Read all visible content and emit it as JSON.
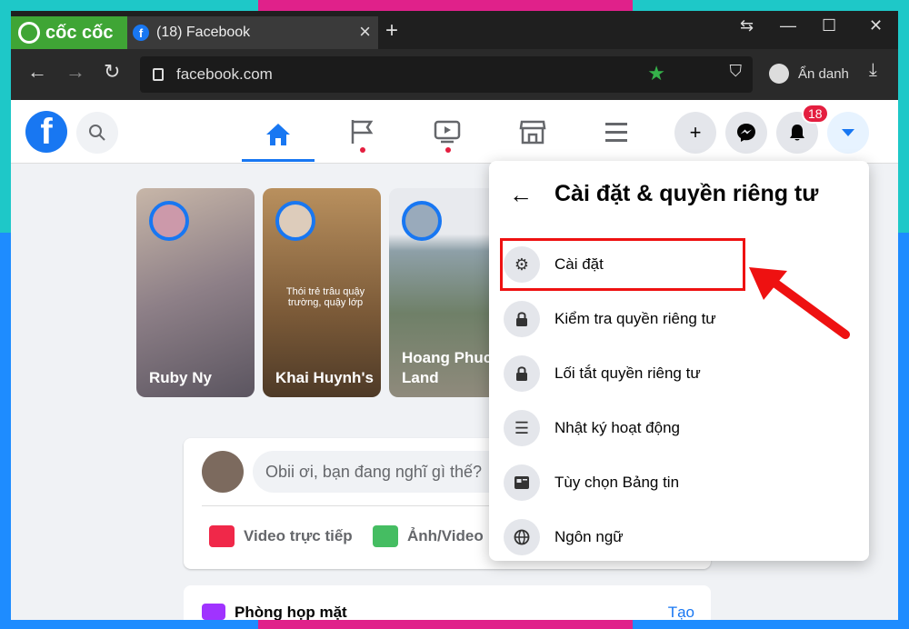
{
  "browser": {
    "brand": "cốc cốc",
    "tab_title": "(18) Facebook",
    "tab_favicon": "f",
    "url": "facebook.com",
    "incognito_label": "Ẩn danh"
  },
  "facebook": {
    "notification_count": "18"
  },
  "stories": [
    {
      "name": "Ruby Ny",
      "caption": ""
    },
    {
      "name": "Khai Huynh's",
      "caption": "Thói trẻ trâu quậy trường, quậy lớp"
    },
    {
      "name": "Hoang Phuc Land",
      "caption": ""
    }
  ],
  "composer": {
    "placeholder": "Obii ơi, bạn đang nghĩ gì thế?",
    "live_video": "Video trực tiếp",
    "photo_video": "Ảnh/Video"
  },
  "rooms": {
    "title": "Phòng họp mặt",
    "create": "Tạo"
  },
  "dropdown": {
    "title": "Cài đặt & quyền riêng tư",
    "items": [
      {
        "label": "Cài đặt",
        "icon": "gear-icon"
      },
      {
        "label": "Kiểm tra quyền riêng tư",
        "icon": "lock-heart-icon"
      },
      {
        "label": "Lối tắt quyền riêng tư",
        "icon": "lock-icon"
      },
      {
        "label": "Nhật ký hoạt động",
        "icon": "list-icon"
      },
      {
        "label": "Tùy chọn Bảng tin",
        "icon": "feed-icon"
      },
      {
        "label": "Ngôn ngữ",
        "icon": "globe-icon"
      }
    ]
  },
  "colors": {
    "facebook_blue": "#1877f2",
    "highlight_red": "#e11111",
    "coccoc_green": "#3fa535"
  }
}
